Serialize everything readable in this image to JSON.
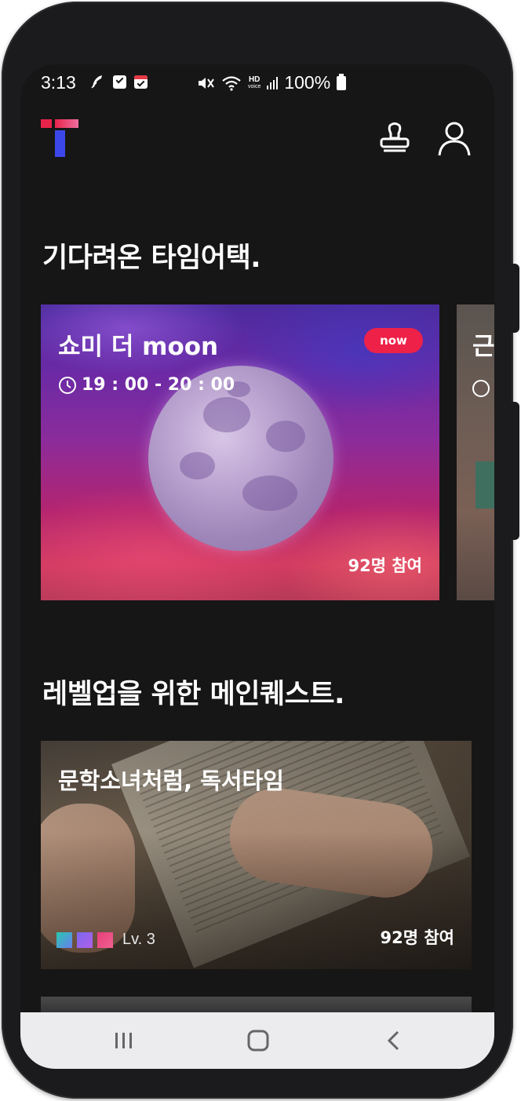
{
  "status_bar": {
    "time": "3:13",
    "hd_label": "HD",
    "voice_label": "voice",
    "battery": "100%"
  },
  "header": {
    "logo_icon": "t-logo-icon",
    "stamp_icon": "stamp-icon",
    "profile_icon": "user-icon"
  },
  "time_attack": {
    "title": "기다려온 타임어택.",
    "cards": [
      {
        "title": "쇼미 더 moon",
        "time": "19 : 00 - 20 : 00",
        "badge": "now",
        "participants": "92명 참여"
      },
      {
        "title": "근"
      }
    ]
  },
  "main_quest": {
    "title": "레벨업을 위한 메인퀘스트.",
    "cards": [
      {
        "title": "문학소녀처럼, 독서타임",
        "level": "Lv. 3",
        "participants": "92명 참여"
      }
    ]
  },
  "colors": {
    "background": "#161616",
    "accent": "#ee2149",
    "logo_red": "#e8234a",
    "logo_blue": "#3b47e8",
    "level_colors": [
      "#29c7b0",
      "#7b67f0",
      "#e8407a"
    ]
  }
}
